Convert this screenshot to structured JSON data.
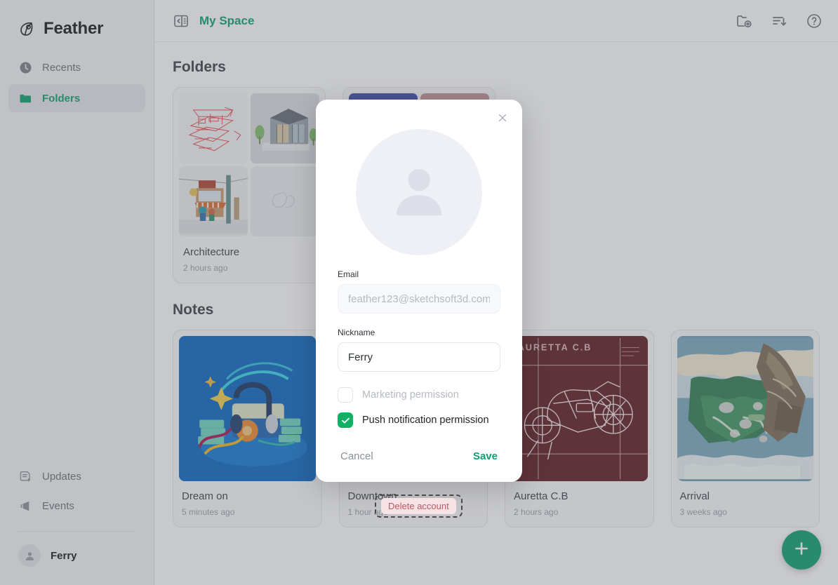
{
  "brand": {
    "name": "Feather",
    "icon": "feather-icon"
  },
  "sidebar": {
    "items": [
      {
        "label": "Recents",
        "icon": "clock-icon",
        "active": false
      },
      {
        "label": "Folders",
        "icon": "folder-icon",
        "active": true
      }
    ],
    "bottom_items": [
      {
        "label": "Updates",
        "icon": "note-plus-icon"
      },
      {
        "label": "Events",
        "icon": "megaphone-icon"
      }
    ],
    "user": {
      "name": "Ferry",
      "avatar": "person-icon"
    }
  },
  "header": {
    "collapse_icon": "sidebar-collapse-icon",
    "title": "My Space",
    "actions": [
      {
        "name": "new-folder-icon",
        "label": "New folder"
      },
      {
        "name": "sort-icon",
        "label": "Sort"
      },
      {
        "name": "help-icon",
        "label": "Help"
      }
    ]
  },
  "main": {
    "folders_title": "Folders",
    "notes_title": "Notes",
    "folders": [
      {
        "name": "Architecture",
        "time": "2 hours ago"
      },
      {
        "name": "",
        "time": ""
      }
    ],
    "notes": [
      {
        "name": "Dream on",
        "time": "5 minutes ago"
      },
      {
        "name": "Downtown",
        "time": "1 hour ago"
      },
      {
        "name": "Auretta C.B",
        "time": "2 hours ago"
      },
      {
        "name": "Arrival",
        "time": "3 weeks ago"
      }
    ]
  },
  "fab": {
    "icon": "plus-icon",
    "label": "Create"
  },
  "modal": {
    "close_icon": "close-icon",
    "avatar_icon": "person-icon",
    "email": {
      "label": "Email",
      "value": "",
      "placeholder": "feather123@sketchsoft3d.com"
    },
    "nickname": {
      "label": "Nickname",
      "value": "Ferry",
      "placeholder": ""
    },
    "checkboxes": [
      {
        "label": "Marketing permission",
        "checked": false
      },
      {
        "label": "Push notification permission",
        "checked": true
      }
    ],
    "cancel_label": "Cancel",
    "save_label": "Save"
  },
  "delete_account": {
    "label": "Delete account"
  },
  "colors": {
    "accent_green": "#0ca06c",
    "check_green": "#11b065",
    "sidebar_bg": "#f3f4f6",
    "delete_bg": "#f7e3e5",
    "delete_text": "#b85a63"
  }
}
